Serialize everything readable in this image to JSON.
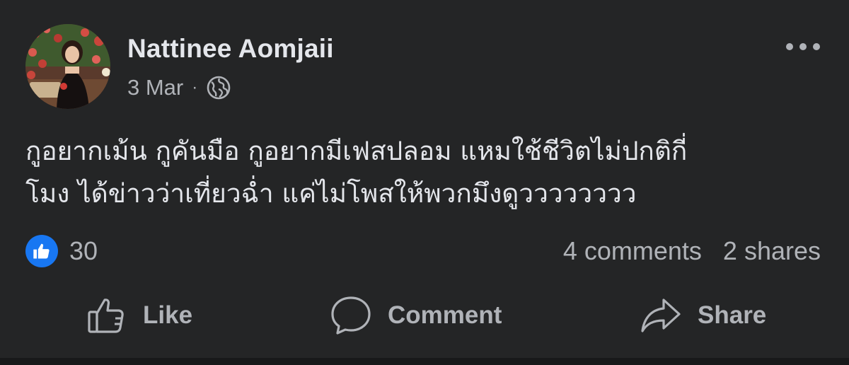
{
  "post": {
    "author": "Nattinee Aomjaii",
    "date": "3 Mar",
    "separator": "·",
    "privacy_icon": "globe-icon",
    "more_icon": "more-options-icon",
    "text_lines": [
      "กูอยากเม้น กูคันมือ กูอยากมีเฟสปลอม  แหมใช้ชีวิตไม่ปกติกี่",
      "โมง ได้ข่าวว่าเที่ยวฉ่ำ แค่ไม่โพสให้พวกมึงดูวววววววว"
    ]
  },
  "stats": {
    "reaction_icon": "like-reaction-icon",
    "reaction_count": "30",
    "comments": "4 comments",
    "shares": "2 shares"
  },
  "actions": {
    "like_label": "Like",
    "comment_label": "Comment",
    "share_label": "Share"
  },
  "colors": {
    "background": "#242526",
    "primary_text": "#e4e6eb",
    "secondary_text": "#b0b3b8",
    "like_blue": "#1877f2"
  }
}
